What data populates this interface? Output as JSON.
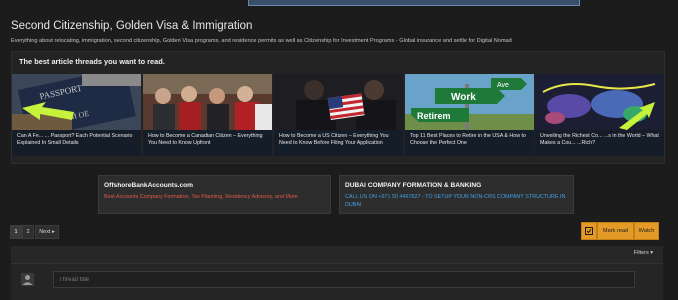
{
  "forum": {
    "title": "Second Citizenship, Golden Visa & Immigration",
    "description": "Everything about relocating, immigration, second citizenship, Golden Visa programs, and residence permits as well as Citizenship for Investment Programs - Global insurance and settle for Digital Nomad"
  },
  "featured": {
    "heading": "The best article threads you want to read.",
    "cards": [
      {
        "title": "Can A Fe... ... Passport? Each Potential Scenario Explained In Small Details"
      },
      {
        "title": "How to Become a Canadian Citizen – Everything You Need to Know Upfront"
      },
      {
        "title": "How to Become a US Citizen – Everything You Need to Know Before Filing Your Application"
      },
      {
        "title": "Top 11 Best Places to Retire in the USA & How to Choose the Perfect One"
      },
      {
        "title": "Unveiling the Richest Co... ...s in the World – What Makes a Cou... ...Rich?"
      }
    ]
  },
  "ads": [
    {
      "title": "OffshoreBankAccounts.com",
      "line": "Best Accounts Company Formation, Tax Planning, Residency Advisory, and More",
      "line_color": "#e05a4a"
    },
    {
      "title": "DUBAI COMPANY FORMATION & BANKING",
      "line": "CALL US ON +971 50 4467827  - TO SETUP YOUR NON-CRS COMPANY STRUCTURE IN DUBAI",
      "line_color": "#3ea0e6"
    }
  ],
  "pagination": {
    "pages": [
      "1",
      "2"
    ],
    "next": "Next ▸"
  },
  "actions": {
    "mark_read": "Mark read",
    "watch": "Watch"
  },
  "list": {
    "filters": "Filters ▾",
    "title_placeholder": "Thread title"
  },
  "colors": {
    "accent": "#e39a26",
    "annotation_arrow": "#c6f23c"
  }
}
